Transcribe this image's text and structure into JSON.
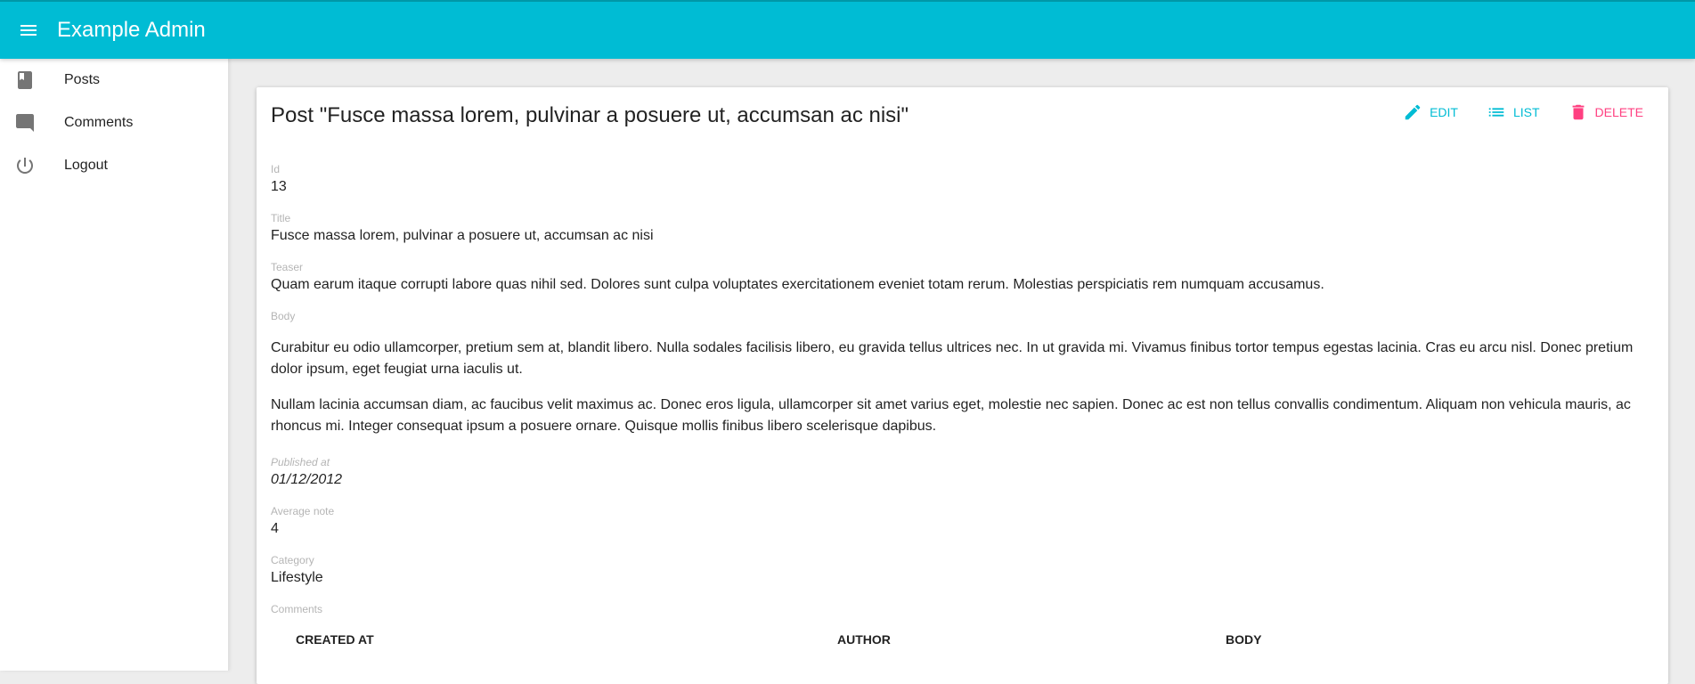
{
  "appbar": {
    "title": "Example Admin",
    "menu_icon": "menu-icon"
  },
  "sidebar": {
    "items": [
      {
        "label": "Posts",
        "icon": "book-icon"
      },
      {
        "label": "Comments",
        "icon": "comment-icon"
      },
      {
        "label": "Logout",
        "icon": "power-icon"
      }
    ]
  },
  "page": {
    "title": "Post \"Fusce massa lorem, pulvinar a posuere ut, accumsan ac nisi\"",
    "actions": [
      {
        "label": "EDIT",
        "icon": "edit-icon",
        "color": "#00bcd4"
      },
      {
        "label": "LIST",
        "icon": "list-icon",
        "color": "#00bcd4"
      },
      {
        "label": "DELETE",
        "icon": "delete-icon",
        "color": "#ff4081"
      }
    ]
  },
  "fields": {
    "id": {
      "label": "Id",
      "value": "13"
    },
    "title": {
      "label": "Title",
      "value": "Fusce massa lorem, pulvinar a posuere ut, accumsan ac nisi"
    },
    "teaser": {
      "label": "Teaser",
      "value": "Quam earum itaque corrupti labore quas nihil sed. Dolores sunt culpa voluptates exercitationem eveniet totam rerum. Molestias perspiciatis rem numquam accusamus."
    },
    "body": {
      "label": "Body",
      "paragraphs": [
        "Curabitur eu odio ullamcorper, pretium sem at, blandit libero. Nulla sodales facilisis libero, eu gravida tellus ultrices nec. In ut gravida mi. Vivamus finibus tortor tempus egestas lacinia. Cras eu arcu nisl. Donec pretium dolor ipsum, eget feugiat urna iaculis ut.",
        "Nullam lacinia accumsan diam, ac faucibus velit maximus ac. Donec eros ligula, ullamcorper sit amet varius eget, molestie nec sapien. Donec ac est non tellus convallis condimentum. Aliquam non vehicula mauris, ac rhoncus mi. Integer consequat ipsum a posuere ornare. Quisque mollis finibus libero scelerisque dapibus."
      ]
    },
    "published_at": {
      "label": "Published at",
      "value": "01/12/2012"
    },
    "average_note": {
      "label": "Average note",
      "value": "4"
    },
    "category": {
      "label": "Category",
      "value": "Lifestyle"
    },
    "comments": {
      "label": "Comments",
      "columns": [
        "CREATED AT",
        "AUTHOR",
        "BODY"
      ]
    }
  },
  "colors": {
    "primary": "#00bcd4",
    "accent": "#ff4081"
  }
}
